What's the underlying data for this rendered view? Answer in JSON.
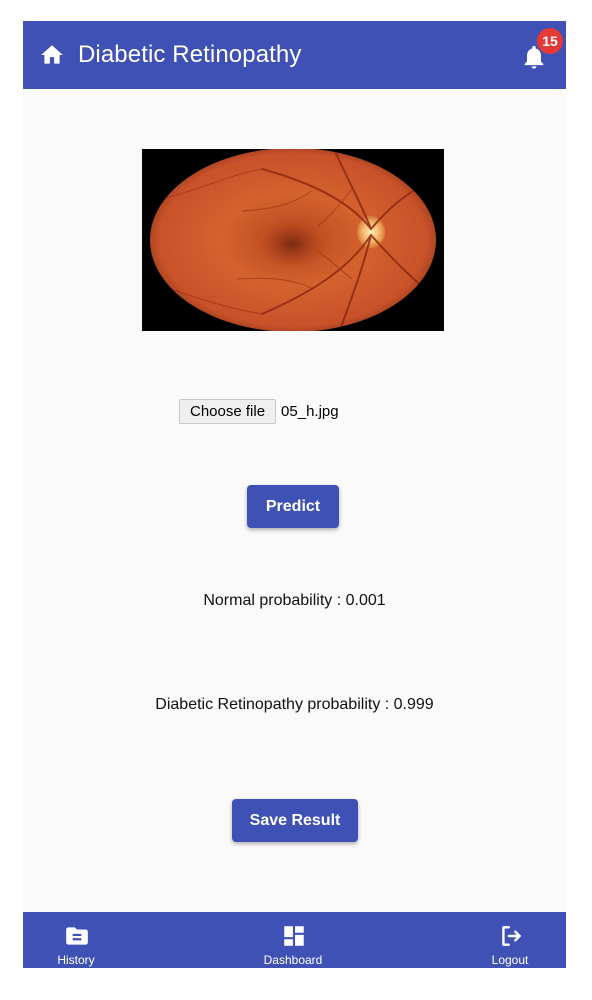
{
  "appbar": {
    "title": "Diabetic Retinopathy",
    "home_icon": "home-icon",
    "bell_icon": "bell-icon",
    "notification_count": "15"
  },
  "image": {
    "icon": "retina-fundus-image"
  },
  "file_input": {
    "button_label": "Choose file",
    "file_name": "05_h.jpg"
  },
  "predict": {
    "label": "Predict"
  },
  "results": {
    "normal": "Normal probability : 0.001",
    "dr": "Diabetic Retinopathy probability : 0.999"
  },
  "save": {
    "label": "Save Result"
  },
  "bottom_nav": {
    "items": [
      {
        "label": "History",
        "icon": "folder-icon"
      },
      {
        "label": "Dashboard",
        "icon": "dashboard-icon"
      },
      {
        "label": "Logout",
        "icon": "logout-icon"
      }
    ]
  },
  "colors": {
    "primary": "#3f51b5",
    "badge": "#e53935",
    "background": "#fafafa"
  }
}
